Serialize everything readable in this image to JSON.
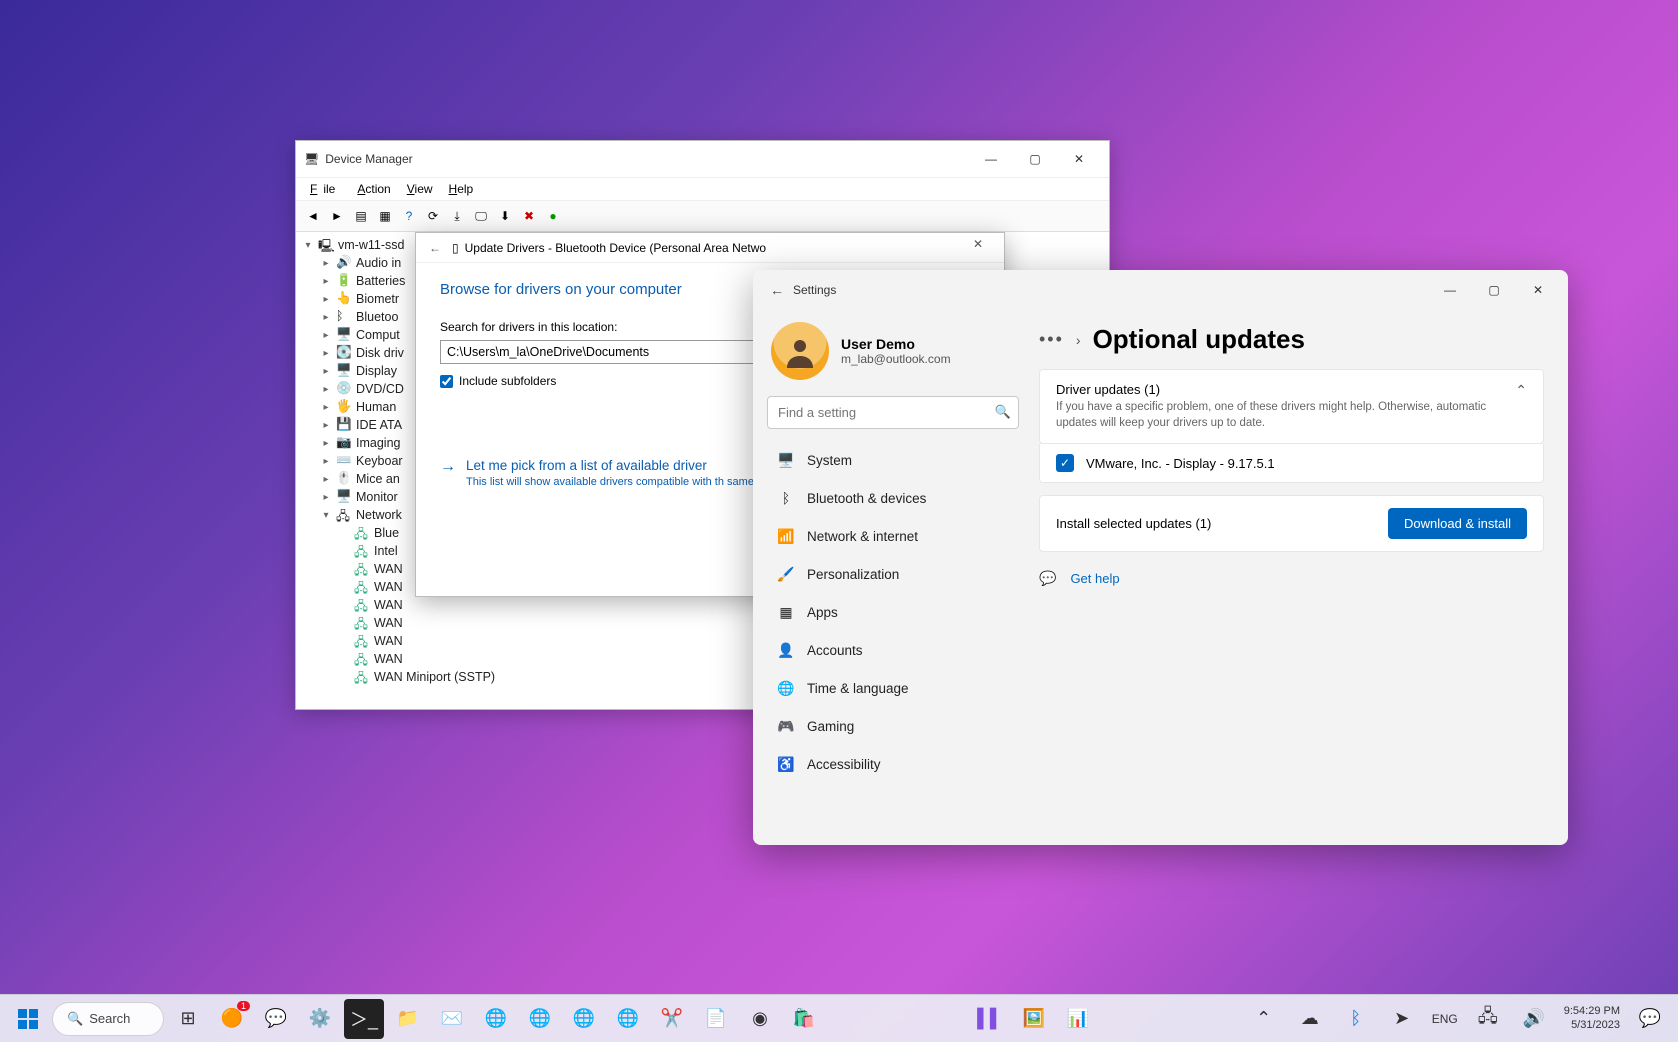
{
  "devmgr": {
    "title": "Device Manager",
    "menu": {
      "file": "File",
      "action": "Action",
      "view": "View",
      "help": "Help"
    },
    "root": "vm-w11-ssd",
    "nodes": [
      "Audio in",
      "Batteries",
      "Biometr",
      "Bluetoo",
      "Comput",
      "Disk driv",
      "Display",
      "DVD/CD",
      "Human",
      "IDE ATA",
      "Imaging",
      "Keyboar",
      "Mice an",
      "Monitor",
      "Network"
    ],
    "network_children": [
      "Blue",
      "Intel",
      "WAN",
      "WAN",
      "WAN",
      "WAN",
      "WAN",
      "WAN",
      "WAN Miniport (SSTP)"
    ]
  },
  "updrv": {
    "title": "Update Drivers - Bluetooth Device (Personal Area Netwo",
    "heading": "Browse for drivers on your computer",
    "search_label": "Search for drivers in this location:",
    "path": "C:\\Users\\m_la\\OneDrive\\Documents",
    "include_label": "Include subfolders",
    "pick_title": "Let me pick from a list of available driver",
    "pick_desc": "This list will show available drivers compatible with th same category as the device."
  },
  "settings": {
    "app_label": "Settings",
    "user": {
      "name": "User Demo",
      "email": "m_lab@outlook.com"
    },
    "search_placeholder": "Find a setting",
    "nav": [
      {
        "icon": "🖥️",
        "label": "System"
      },
      {
        "icon": "ᛒ",
        "label": "Bluetooth & devices"
      },
      {
        "icon": "📶",
        "label": "Network & internet"
      },
      {
        "icon": "🖌️",
        "label": "Personalization"
      },
      {
        "icon": "▦",
        "label": "Apps"
      },
      {
        "icon": "👤",
        "label": "Accounts"
      },
      {
        "icon": "🌐",
        "label": "Time & language"
      },
      {
        "icon": "🎮",
        "label": "Gaming"
      },
      {
        "icon": "♿",
        "label": "Accessibility"
      }
    ],
    "crumb_dots": "•••",
    "page_title": "Optional updates",
    "driver_title": "Driver updates (1)",
    "driver_sub": "If you have a specific problem, one of these drivers might help. Otherwise, automatic updates will keep your drivers up to date.",
    "driver_item": "VMware, Inc. - Display - 9.17.5.1",
    "install_label": "Install selected updates (1)",
    "download_btn": "Download & install",
    "help": "Get help"
  },
  "taskbar": {
    "search": "Search",
    "tray": {
      "lang": "ENG",
      "time": "9:54:29 PM",
      "date": "5/31/2023"
    }
  }
}
